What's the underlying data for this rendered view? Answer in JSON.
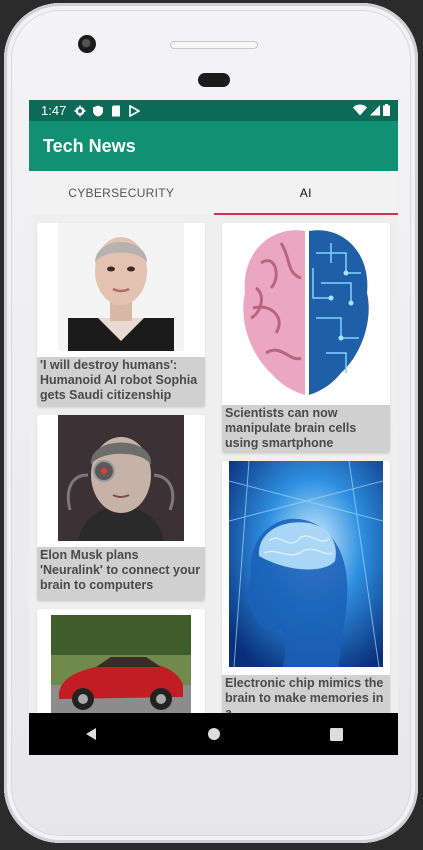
{
  "status_bar": {
    "time": "1:47",
    "left_icons": [
      "gear-icon",
      "shield-icon",
      "sd-card-icon",
      "play-icon"
    ],
    "right_icons": [
      "wifi-icon",
      "signal-icon",
      "battery-icon"
    ]
  },
  "app_bar": {
    "title": "Tech News"
  },
  "tabs": [
    {
      "label": "CYBERSECURITY",
      "selected": false
    },
    {
      "label": "AI",
      "selected": true
    }
  ],
  "accent_colors": {
    "status_bar": "#0c6b58",
    "app_bar": "#119074",
    "tab_indicator": "#d32f4f"
  },
  "articles": [
    {
      "title": "'I will destroy humans': Humanoid AI robot Sophia gets Saudi citizenship",
      "image": "sophia-robot-image"
    },
    {
      "title": "Scientists can now manipulate brain cells using smartphone",
      "image": "brain-circuit-image"
    },
    {
      "title": "Elon Musk plans 'Neuralink' to connect your brain to computers",
      "image": "borg-face-image"
    },
    {
      "title": "Electronic chip mimics the brain to make memories in a",
      "image": "blue-brain-head-image"
    },
    {
      "title": "",
      "image": "red-car-image"
    }
  ],
  "nav_bar": {
    "buttons": [
      "back-icon",
      "home-icon",
      "recents-icon"
    ]
  }
}
